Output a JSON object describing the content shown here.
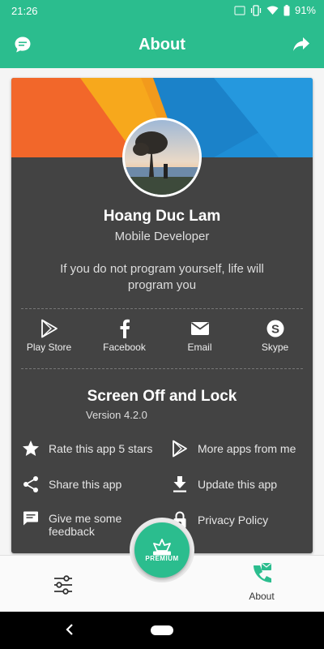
{
  "status_bar": {
    "time": "21:26",
    "battery": "91%"
  },
  "app_bar": {
    "title": "About",
    "left_icon": "message-icon",
    "right_icon": "share-icon"
  },
  "profile": {
    "name": "Hoang Duc Lam",
    "role": "Mobile Developer",
    "quote": "If you do not program yourself, life will program you"
  },
  "contacts": [
    {
      "label": "Play Store",
      "icon": "play-store-icon"
    },
    {
      "label": "Facebook",
      "icon": "facebook-icon"
    },
    {
      "label": "Email",
      "icon": "email-icon"
    },
    {
      "label": "Skype",
      "icon": "skype-icon"
    }
  ],
  "app_info": {
    "name": "Screen Off and Lock",
    "version": "Version 4.2.0"
  },
  "actions": [
    {
      "label": "Rate this app 5 stars",
      "icon": "star-icon"
    },
    {
      "label": "More apps from me",
      "icon": "play-icon"
    },
    {
      "label": "Share this app",
      "icon": "share-icon"
    },
    {
      "label": "Update this app",
      "icon": "download-icon"
    },
    {
      "label": "Give me some feedback",
      "icon": "feedback-icon"
    },
    {
      "label": "Privacy Policy",
      "icon": "lock-icon"
    }
  ],
  "bottom_nav": {
    "settings_icon": "sliders-icon",
    "premium_label": "PREMIUM",
    "about_label": "About"
  },
  "colors": {
    "primary": "#2bbd8e",
    "card": "#434343",
    "banner_orange": "#f2672a",
    "banner_yellow": "#f7a81c",
    "banner_blue": "#1e8ed6"
  }
}
